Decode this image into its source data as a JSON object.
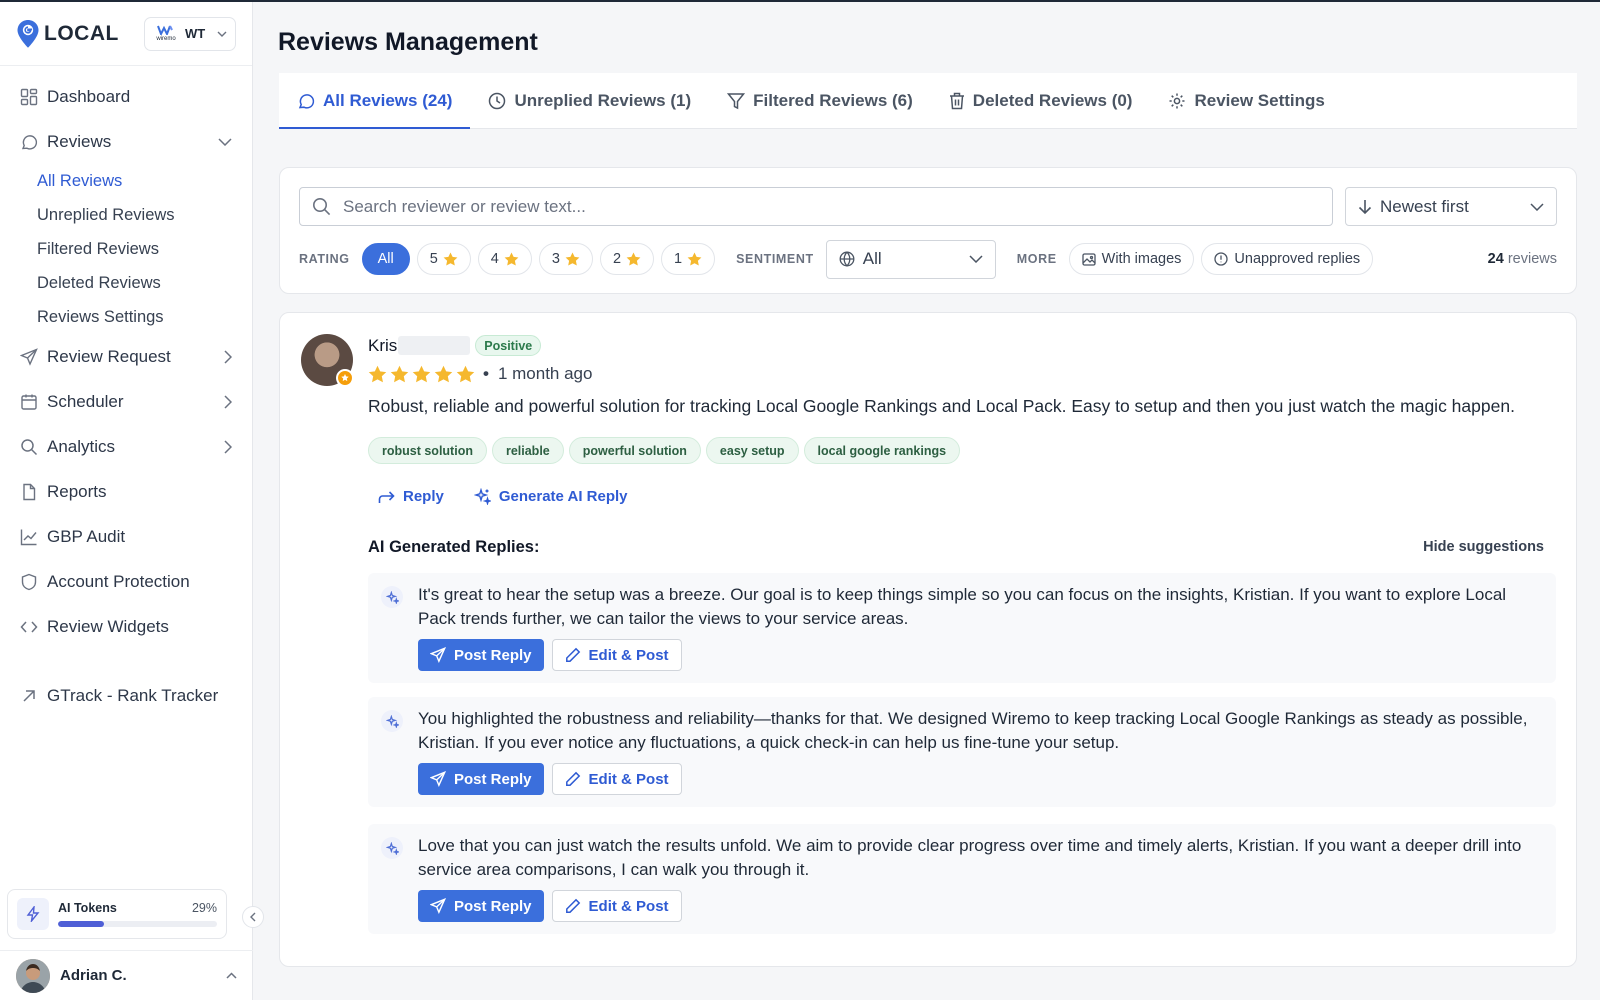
{
  "brand": {
    "name": "LOCAL",
    "workspace_logo_text": "wiremo",
    "workspace_abbr": "WT"
  },
  "sidebar": {
    "items": [
      {
        "label": "Dashboard",
        "icon": "grid-icon"
      },
      {
        "label": "Reviews",
        "icon": "chat-icon",
        "expanded": true,
        "children": [
          "All Reviews",
          "Unreplied Reviews",
          "Filtered Reviews",
          "Deleted Reviews",
          "Reviews Settings"
        ],
        "active_child": "All Reviews"
      },
      {
        "label": "Review Request",
        "icon": "send-icon"
      },
      {
        "label": "Scheduler",
        "icon": "calendar-icon"
      },
      {
        "label": "Analytics",
        "icon": "search-icon"
      },
      {
        "label": "Reports",
        "icon": "file-icon"
      },
      {
        "label": "GBP Audit",
        "icon": "chart-icon"
      },
      {
        "label": "Account Protection",
        "icon": "shield-icon"
      },
      {
        "label": "Review Widgets",
        "icon": "code-icon"
      },
      {
        "label": "GTrack - Rank Tracker",
        "icon": "external-link-icon"
      }
    ],
    "tokens": {
      "label": "AI Tokens",
      "percent_text": "29%",
      "fraction": 0.29
    },
    "user": {
      "name": "Adrian C."
    }
  },
  "page": {
    "title": "Reviews Management"
  },
  "tabs": [
    {
      "label": "All Reviews (24)",
      "icon": "chat-icon",
      "active": true
    },
    {
      "label": "Unreplied Reviews (1)",
      "icon": "clock-icon"
    },
    {
      "label": "Filtered Reviews (6)",
      "icon": "filter-icon"
    },
    {
      "label": "Deleted Reviews (0)",
      "icon": "trash-icon"
    },
    {
      "label": "Review Settings",
      "icon": "gear-icon"
    }
  ],
  "filters": {
    "search_placeholder": "Search reviewer or review text...",
    "sort_value": "Newest first",
    "rating_label": "RATING",
    "rating_options": [
      "All",
      "5",
      "4",
      "3",
      "2",
      "1"
    ],
    "sentiment_label": "SENTIMENT",
    "sentiment_value": "All",
    "more_label": "MORE",
    "more_options": [
      "With images",
      "Unapproved replies"
    ],
    "count_number": "24",
    "count_suffix": "reviews"
  },
  "review": {
    "reviewer_name": "Kris",
    "sentiment": "Positive",
    "rating": 5,
    "time_ago": "1 month ago",
    "text": "Robust, reliable and powerful solution for tracking Local Google Rankings and Local Pack. Easy to setup and then you just watch the magic happen.",
    "tags": [
      "robust solution",
      "reliable",
      "powerful solution",
      "easy setup",
      "local google rankings"
    ],
    "actions": {
      "reply": "Reply",
      "generate": "Generate AI Reply"
    },
    "ai_title": "AI Generated Replies:",
    "hide_label": "Hide suggestions",
    "suggestions": [
      "It's great to hear the setup was a breeze. Our goal is to keep things simple so you can focus on the insights, Kristian. If you want to explore Local Pack trends further, we can tailor the views to your service areas.",
      "You highlighted the robustness and reliability—thanks for that. We designed Wiremo to keep tracking Local Google Rankings as steady as possible, Kristian. If you ever notice any fluctuations, a quick check-in can help us fine-tune your setup.",
      "Love that you can just watch the results unfold. We aim to provide clear progress over time and timely alerts, Kristian. If you want a deeper drill into service area comparisons, I can walk you through it."
    ],
    "post_label": "Post Reply",
    "edit_label": "Edit & Post"
  },
  "colors": {
    "accent": "#2f5bd3",
    "button": "#3b6fdc",
    "star": "#f5b82e",
    "positive_bg": "#e8f7ee"
  }
}
